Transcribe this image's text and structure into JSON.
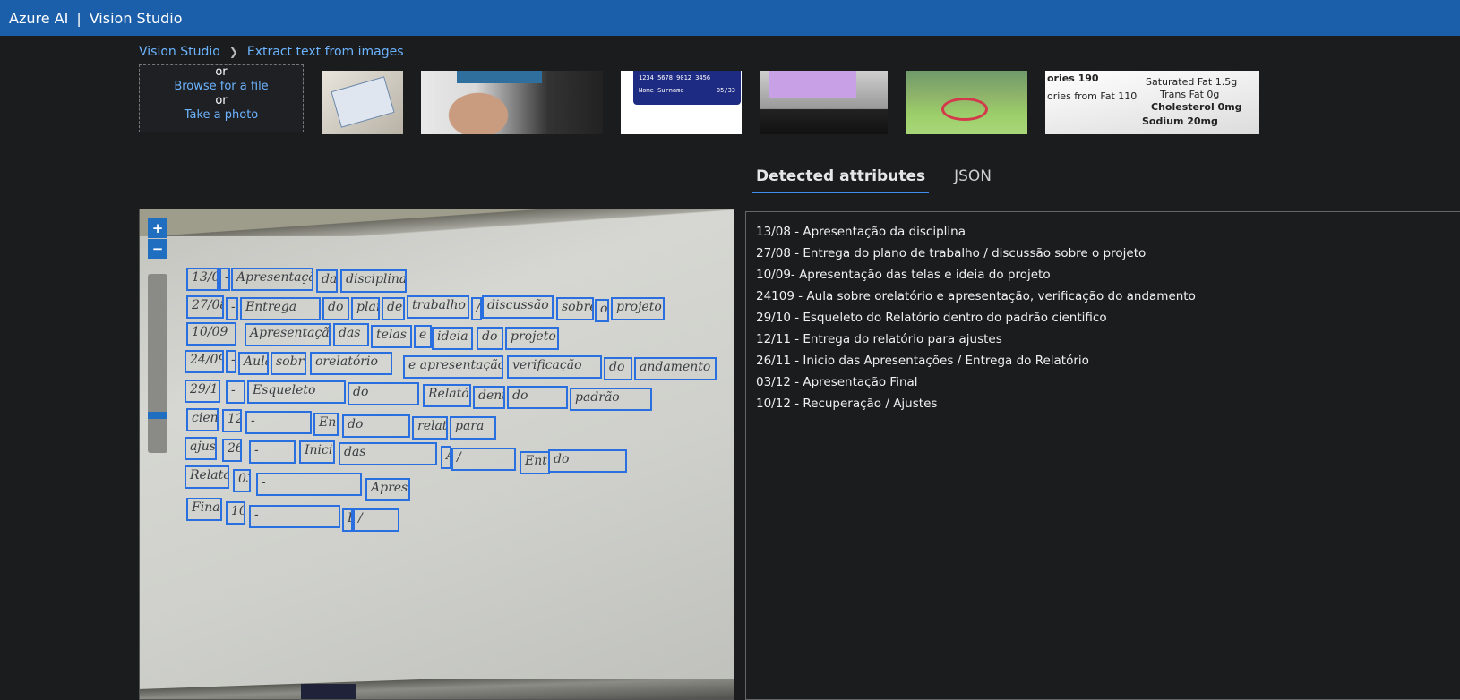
{
  "header": {
    "brand": "Azure AI",
    "separator": "|",
    "product": "Vision Studio"
  },
  "breadcrumb": {
    "home": "Vision Studio",
    "current": "Extract text from images"
  },
  "upload": {
    "or_1": "or",
    "browse_label": "Browse for a file",
    "or_2": "or",
    "take_photo_label": "Take a photo"
  },
  "samples": {
    "credit_card_number": "1234 5678 9012 3456",
    "credit_card_name": "Nome Surname",
    "credit_card_expiry": "05/33",
    "nutrition_lines": [
      "ories 190",
      "Saturated Fat 1.5g",
      "ories from Fat 110",
      "Trans Fat 0g",
      "Cholesterol 0mg",
      "Sodium 20mg"
    ]
  },
  "tabs": [
    {
      "label": "Detected attributes",
      "active": true
    },
    {
      "label": "JSON",
      "active": false
    }
  ],
  "viewer": {
    "zoom_in": "+",
    "zoom_out": "−",
    "zoom_level_fraction": 0.8,
    "detected_words": [
      "13/08",
      "-",
      "Apresentação",
      "da",
      "disciplina",
      "27/08",
      "-",
      "Entrega",
      "do",
      "plano",
      "de",
      "trabalho",
      "/",
      "discussão",
      "sobre",
      "o",
      "projeto",
      "10/09",
      "Apresentação",
      "das",
      "telas",
      "e",
      "ideia",
      "do",
      "projeto",
      "24/09",
      "-",
      "Aula",
      "sobre",
      "orelatório",
      "e apresentação",
      "verificação",
      "do",
      "andamento",
      "29/10",
      "-",
      "Esqueleto",
      "do",
      "Relatório",
      "dentro",
      "do",
      "padrão",
      "cientifico",
      "12/11",
      "-",
      "Entrega",
      "do",
      "relatório",
      "para",
      "ajustes",
      "26/11",
      "-",
      "Inicio",
      "das",
      "Apresentações",
      "/",
      "Entrega",
      "do",
      "Relatório",
      "03/12",
      "-",
      "Apresentação",
      "Final",
      "10/12",
      "-",
      "Recuperação",
      "/",
      "Ajustes"
    ]
  },
  "results": [
    "13/08 - Apresentação da disciplina",
    "27/08 - Entrega do plano de trabalho / discussão sobre o projeto",
    "10/09- Apresentação das telas e ideia do projeto",
    "24109 - Aula sobre orelatório e apresentação, verificação do andamento",
    "29/10 - Esqueleto do Relatório dentro do padrão cientifico",
    "12/11 - Entrega do relatório para ajustes",
    "26/11 - Inicio das Apresentações / Entrega do Relatório",
    "03/12 - Apresentação Final",
    "10/12 - Recuperação / Ajustes"
  ]
}
